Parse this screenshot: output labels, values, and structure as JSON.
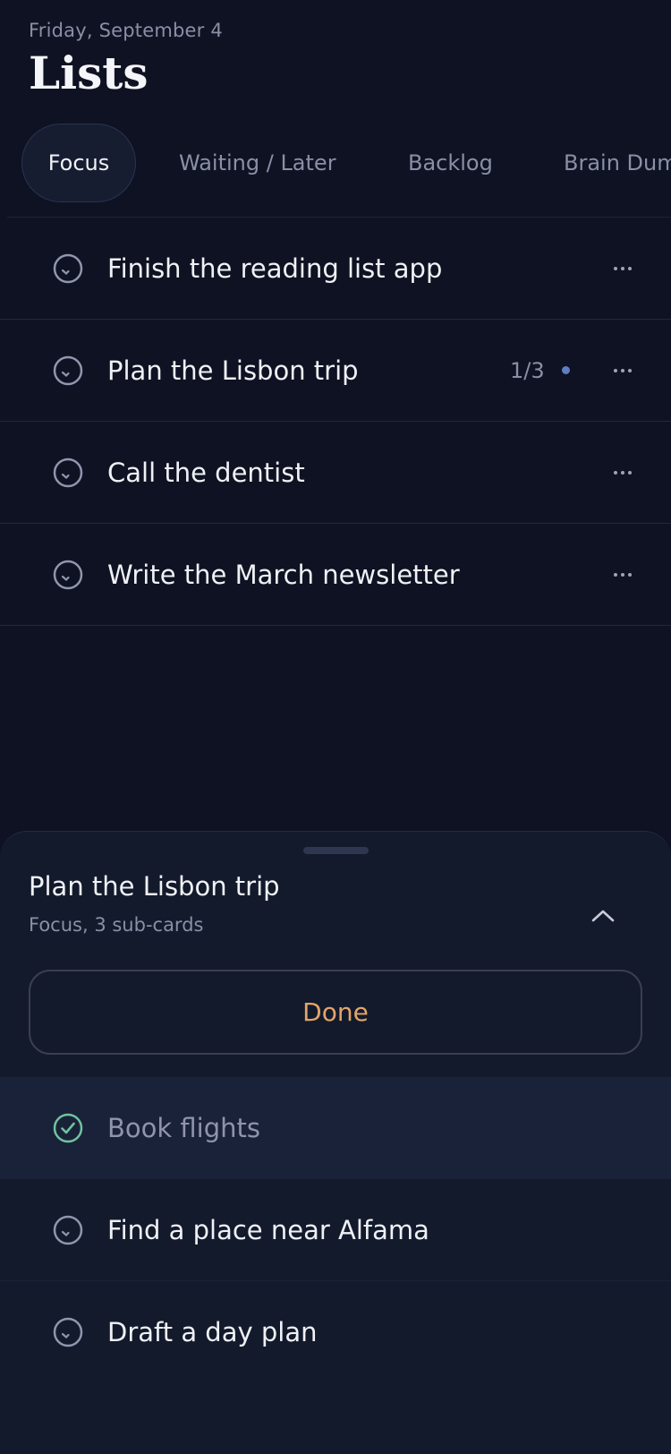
{
  "header": {
    "date": "Friday, September 4",
    "title": "Lists"
  },
  "tabs": [
    {
      "label": "Focus",
      "active": true
    },
    {
      "label": "Waiting / Later",
      "active": false
    },
    {
      "label": "Backlog",
      "active": false
    },
    {
      "label": "Brain Dump",
      "active": false
    }
  ],
  "tasks": [
    {
      "label": "Finish the reading list app"
    },
    {
      "label": "Plan the Lisbon trip",
      "progress": "1/3"
    },
    {
      "label": "Call the dentist"
    },
    {
      "label": "Write the March newsletter"
    }
  ],
  "sheet": {
    "title": "Plan the Lisbon trip",
    "subtitle": "Focus, 3 sub-cards",
    "done_label": "Done",
    "subtasks": [
      {
        "label": "Book flights",
        "completed": true
      },
      {
        "label": "Find a place near Alfama",
        "completed": false
      },
      {
        "label": "Draft a day plan",
        "completed": false
      }
    ]
  },
  "colors": {
    "background": "#0e1222",
    "sheet": "#131a2c",
    "accent_done": "#e2a569",
    "check_complete": "#6fc3a0",
    "progress_dot": "#5f7dc5"
  },
  "icons": {
    "open_check": "circle-check-outline-icon",
    "done_check": "circle-check-filled-icon",
    "more": "more-horizontal-icon",
    "collapse": "chevron-up-icon"
  }
}
